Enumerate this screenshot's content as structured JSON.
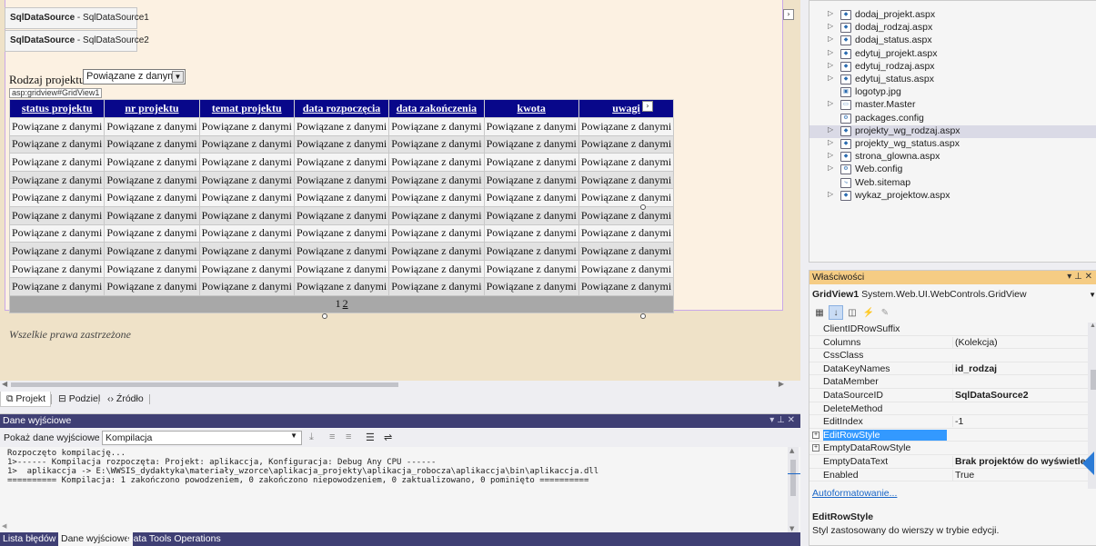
{
  "designer": {
    "datasource1": {
      "type": "SqlDataSource",
      "name": "SqlDataSource1"
    },
    "datasource2": {
      "type": "SqlDataSource",
      "name": "SqlDataSource2"
    },
    "rodzaj_label": "Rodzaj projektu:",
    "rodzaj_select_value": "Powiązane z danymi",
    "gridview_tag": "asp:gridview#GridView1",
    "gridview": {
      "columns": [
        "status projektu",
        "nr projektu",
        "temat projektu",
        "data rozpoczęcia",
        "data zakończenia",
        "kwota",
        "uwagi"
      ],
      "cell_text": "Powiązane z danymi",
      "row_count": 10,
      "pager_current": "1",
      "pager_link": "2"
    },
    "footer_text": "Wszelkie prawa zastrzeżone"
  },
  "view_tabs": [
    {
      "icon": "design-icon",
      "label": "Projekt"
    },
    {
      "icon": "split-icon",
      "label": "Podziel"
    },
    {
      "icon": "source-icon",
      "label": "Źródło"
    }
  ],
  "output": {
    "title": "Dane wyjściowe",
    "source_label": "Pokaż dane wyjściowe z:",
    "source_value": "Kompilacja",
    "lines": [
      "Rozpoczęto kompilację...",
      "1>------ Kompilacja rozpoczęta: Projekt: aplikaccja, Konfiguracja: Debug Any CPU ------",
      "1>  aplikaccja -> E:\\WWSIS_dydaktyka\\materiały_wzorce\\aplikacja_projekty\\aplikacja_robocza\\aplikaccja\\bin\\aplikaccja.dll",
      "========== Kompilacja: 1 zakończono powodzeniem, 0 zakończono niepowodzeniem, 0 zaktualizowano, 0 pominięto =========="
    ]
  },
  "bottom_tabs": [
    {
      "label": "Lista błędów",
      "active": false
    },
    {
      "label": "Dane wyjściowe",
      "active": true
    },
    {
      "label": "Data Tools Operations",
      "active": false
    }
  ],
  "solution_explorer": {
    "items": [
      {
        "label": "dodaj_projekt.aspx",
        "expandable": true,
        "icon": "aspx-file-icon"
      },
      {
        "label": "dodaj_rodzaj.aspx",
        "expandable": true,
        "icon": "aspx-file-icon"
      },
      {
        "label": "dodaj_status.aspx",
        "expandable": true,
        "icon": "aspx-file-icon"
      },
      {
        "label": "edytuj_projekt.aspx",
        "expandable": true,
        "icon": "aspx-file-icon"
      },
      {
        "label": "edytuj_rodzaj.aspx",
        "expandable": true,
        "icon": "aspx-file-icon"
      },
      {
        "label": "edytuj_status.aspx",
        "expandable": true,
        "icon": "aspx-file-icon"
      },
      {
        "label": "logotyp.jpg",
        "expandable": false,
        "icon": "image-file-icon"
      },
      {
        "label": "master.Master",
        "expandable": true,
        "icon": "master-file-icon"
      },
      {
        "label": "packages.config",
        "expandable": false,
        "icon": "config-file-icon"
      },
      {
        "label": "projekty_wg_rodzaj.aspx",
        "expandable": true,
        "icon": "aspx-file-icon",
        "selected": true
      },
      {
        "label": "projekty_wg_status.aspx",
        "expandable": true,
        "icon": "aspx-file-icon"
      },
      {
        "label": "strona_glowna.aspx",
        "expandable": true,
        "icon": "aspx-file-icon"
      },
      {
        "label": "Web.config",
        "expandable": true,
        "icon": "config-file-icon"
      },
      {
        "label": "Web.sitemap",
        "expandable": false,
        "icon": "sitemap-file-icon"
      },
      {
        "label": "wykaz_projektow.aspx",
        "expandable": true,
        "icon": "aspx-file-icon"
      }
    ]
  },
  "properties": {
    "title": "Właściwości",
    "object_name": "GridView1",
    "object_type": "System.Web.UI.WebControls.GridView",
    "rows": [
      {
        "name": "ClientIDRowSuffix",
        "value": "",
        "bold": false
      },
      {
        "name": "Columns",
        "value": "(Kolekcja)",
        "bold": false
      },
      {
        "name": "CssClass",
        "value": "",
        "bold": false
      },
      {
        "name": "DataKeyNames",
        "value": "id_rodzaj",
        "bold": true
      },
      {
        "name": "DataMember",
        "value": "",
        "bold": false
      },
      {
        "name": "DataSourceID",
        "value": "SqlDataSource2",
        "bold": true
      },
      {
        "name": "DeleteMethod",
        "value": "",
        "bold": false
      },
      {
        "name": "EditIndex",
        "value": "-1",
        "bold": false
      },
      {
        "name": "EditRowStyle",
        "value": "",
        "bold": false,
        "expandable": true,
        "selected": true
      },
      {
        "name": "EmptyDataRowStyle",
        "value": "",
        "bold": false,
        "expandable": true
      },
      {
        "name": "EmptyDataText",
        "value": "Brak projektów do wyświetlenia.",
        "bold": true
      },
      {
        "name": "Enabled",
        "value": "True",
        "bold": false
      }
    ],
    "autoformat_link": "Autoformatowanie...",
    "description_title": "EditRowStyle",
    "description_text": "Styl zastosowany do wierszy w trybie edycji."
  }
}
